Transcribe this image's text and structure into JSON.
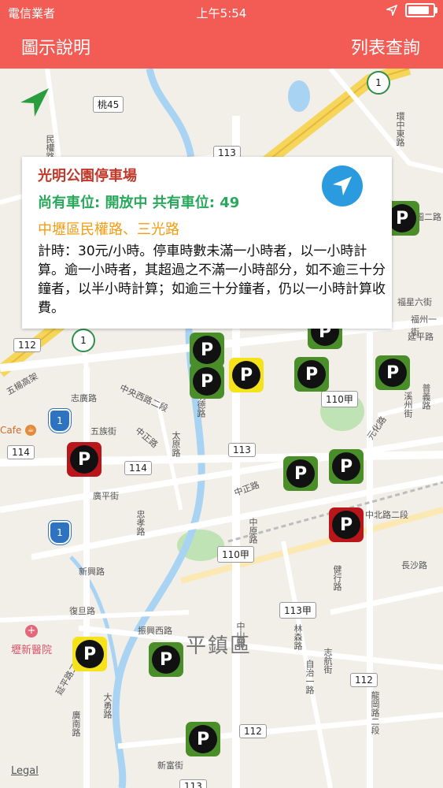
{
  "status_bar": {
    "carrier": "電信業者",
    "time": "上午5:54"
  },
  "nav": {
    "left_label": "圖示說明",
    "right_label": "列表查詢"
  },
  "callout": {
    "name": "光明公園停車場",
    "status": "尚有車位: 開放中  共有車位: 49",
    "address": "中壢區民權路、三光路",
    "description": "計時：30元/小時。停車時數未滿一小時者，以一小時計算。逾一小時者，其超過之不滿一小時部分，如不逾三十分鐘者，以半小時計算；如逾三十分鐘者，仍以一小時計算收費。"
  },
  "map": {
    "road_labels": [
      "桃45",
      "113",
      "112",
      "114",
      "114",
      "113",
      "110甲",
      "110甲",
      "113甲",
      "112",
      "112",
      "113"
    ],
    "shields": [
      "1",
      "1"
    ],
    "flowers": [
      "1",
      "1"
    ],
    "streets": [
      "民權路",
      "五楊高架",
      "志廣路",
      "中央西路二段",
      "中正路",
      "五族街",
      "廣平街",
      "忠孝路",
      "新興路",
      "復旦路",
      "振興西路",
      "延平路二段",
      "大勇路",
      "新富街",
      "中北路二段",
      "長沙路",
      "延平路",
      "福星六街",
      "健行路",
      "林森路",
      "志航街",
      "自治一路",
      "龍岡路二段",
      "元化路",
      "中山路",
      "中原路",
      "福州一街",
      "圖二路",
      "環中東路",
      "普義路",
      "中正路",
      "溪州街",
      "廣南路",
      "明德路",
      "太原路"
    ],
    "district": "平鎮區",
    "pois": [
      "Cafe",
      "壢新醫院"
    ],
    "legal": "Legal"
  },
  "marker_label": "P",
  "colors": {
    "header": "#f25c54",
    "green": "#4a8e2a",
    "yellow": "#f6e21a",
    "red": "#b9161c",
    "nav_button": "#2b9be0"
  }
}
